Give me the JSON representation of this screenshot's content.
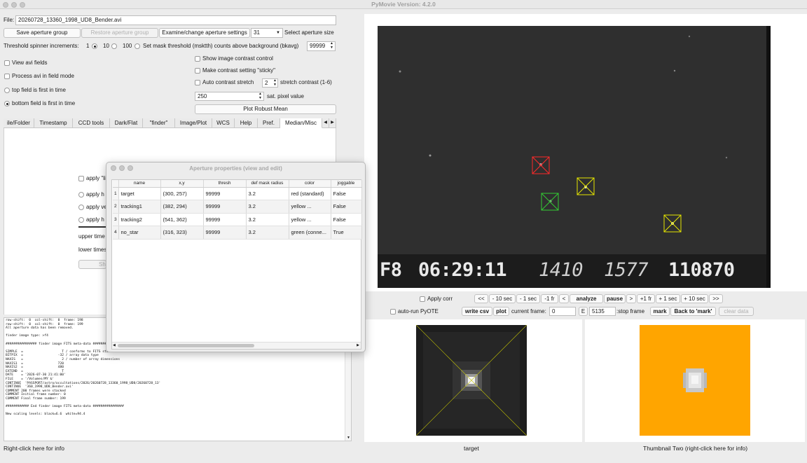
{
  "window": {
    "title": "PyMovie Version: 4.2.0"
  },
  "file": {
    "label": "File:",
    "value": "20260728_13360_1998_UD8_Bender.avi"
  },
  "aperture_row": {
    "save_label": "Save aperture group",
    "restore_label": "Restore aperture group",
    "examine_label": "Examine/change aperture settings",
    "size_value": "31",
    "size_label": "Select aperture size"
  },
  "threshold_row": {
    "label": "Threshold spinner increments:",
    "opt1": "1",
    "opt10": "10",
    "opt100": "100",
    "mask_label": "Set mask threshold (msktth) counts above background (bkavg)",
    "mask_value": "99999"
  },
  "options": {
    "view_avi_fields": "View avi fields",
    "process_field_mode": "Process avi in field mode",
    "top_field_first": "top field is first in time",
    "bottom_field_first": "bottom field is first in time",
    "show_contrast": "Show image contrast control",
    "sticky_contrast": "Make contrast setting \"sticky\"",
    "auto_stretch": "Auto contrast stretch",
    "stretch_value": "2",
    "stretch_label": "stretch contrast (1-6)",
    "sat_value": "250",
    "sat_label": "sat. pixel value",
    "plot_robust_mean": "Plot Robust Mean"
  },
  "tabs": [
    "ile/Folder",
    "Timestamp",
    "CCD tools",
    "Dark/Flat",
    "\"finder\"",
    "Image/Plot",
    "WCS",
    "Help",
    "Pref.",
    "Median/Misc"
  ],
  "hidden_panel": {
    "apply_1": "apply \"li",
    "apply_2": "apply h",
    "apply_3": "apply ve",
    "apply_4": "apply h",
    "upper": "upper time",
    "lower": "lower times",
    "btn": "Sh"
  },
  "dialog": {
    "title": "Aperture properties (view and edit)",
    "headers": [
      "name",
      "x,y",
      "thresh",
      "def mask radius",
      "color",
      "joggable"
    ],
    "rows": [
      {
        "n": "1",
        "name": "target",
        "xy": "(300, 257)",
        "thresh": "99999",
        "radius": "3.2",
        "color": "red (standard)",
        "jog": "False"
      },
      {
        "n": "2",
        "name": "tracking1",
        "xy": "(382, 294)",
        "thresh": "99999",
        "radius": "3.2",
        "color": "yellow ...",
        "jog": "False"
      },
      {
        "n": "3",
        "name": "tracking2",
        "xy": "(541, 362)",
        "thresh": "99999",
        "radius": "3.2",
        "color": "yellow ...",
        "jog": "False"
      },
      {
        "n": "4",
        "name": "no_star",
        "xy": "(316, 323)",
        "thresh": "99999",
        "radius": "3.2",
        "color": "green (conne...",
        "jog": "True"
      }
    ]
  },
  "console": {
    "lines": [
      "row-shift:  0  col-shift:  0  frame: 198",
      "row-shift:  0  col-shift:  0  frame: 199",
      "All aperture data has been removed.",
      "",
      "finder image type: >f4",
      "",
      "################ finder image FITS meta-data ################",
      "",
      "SIMPLE  =                    T / conforms to FITS standard",
      "BITPIX  =                  -32 / array data type",
      "NAXIS   =                    2 / number of array dimensions",
      "NAXIS1  =                  720",
      "NAXIS2  =                  480",
      "EXTEND  =                    T",
      "DATE    = '2026-07-30 21:41:00'",
      "FILE    = '/Volumes/MY &'",
      "CONTINUE  'PASSPORT/astro/occultations/2026/20260728_13360_1998_UD8/20260728_13'",
      "CONTINUE  '360_1998_UD8_Bender.avi'",
      "COMMENT 200 frames were stacked",
      "COMMENT Initial frame number: 0",
      "COMMENT Final frame number: 199",
      "",
      "############ End finder image FITS meta-data ################",
      "",
      "New scaling levels: black=6.6  white=94.4"
    ]
  },
  "image": {
    "osd_f": "F8",
    "osd_time": "06:29:11",
    "osd_n1": "1410",
    "osd_n2": "1577",
    "osd_n3": "110870"
  },
  "controls": {
    "apply_corr": "Apply corr",
    "auto_run": "auto-run PyOTE",
    "nav": [
      "<<",
      "- 10 sec",
      "- 1 sec",
      "-1 fr",
      "<",
      "analyze",
      "pause",
      ">",
      "+1 fr",
      "+ 1 sec",
      "+ 10 sec",
      ">>"
    ],
    "write_csv": "write csv",
    "plot": "plot",
    "current_frame_label": "current frame:",
    "current_frame_value": "0",
    "e_label": "E",
    "stop_frame_value": "5135",
    "stop_frame_label": ":stop frame",
    "mark": "mark",
    "back_to_mark": "Back to 'mark'",
    "clear_data": "clear data"
  },
  "thumbnails": {
    "one_label": "target",
    "two_label": "Thumbnail Two (right-click here for info)"
  },
  "status_bar": {
    "left": "Right-click here for info"
  },
  "colors": {
    "orange": "#ffa500",
    "red": "#ff2a2a",
    "yellow": "#e6e600",
    "green": "#33cc33"
  }
}
